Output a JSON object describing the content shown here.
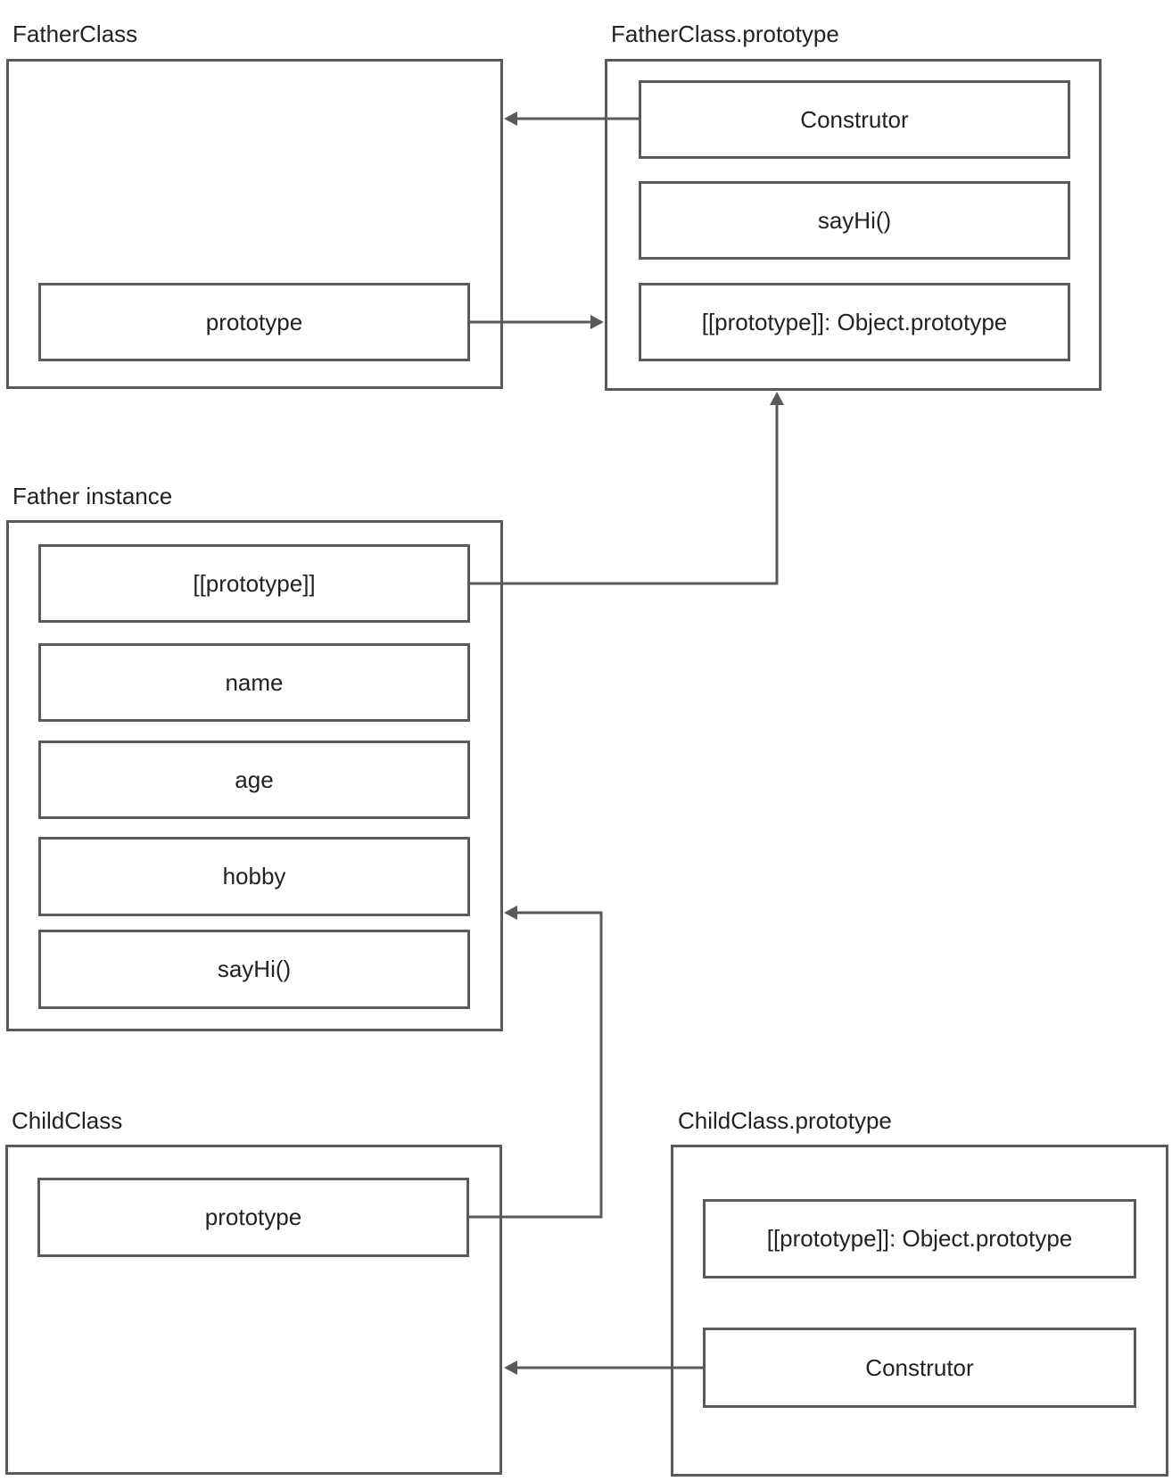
{
  "diagram": {
    "father_class": {
      "label": "FatherClass",
      "fields": [
        "prototype"
      ]
    },
    "father_class_prototype": {
      "label": "FatherClass.prototype",
      "fields": [
        "Construtor",
        "sayHi()",
        "[[prototype]]: Object.prototype"
      ]
    },
    "father_instance": {
      "label": "Father instance",
      "fields": [
        "[[prototype]]",
        "name",
        "age",
        "hobby",
        "sayHi()"
      ]
    },
    "child_class": {
      "label": "ChildClass",
      "fields": [
        "prototype"
      ]
    },
    "child_class_prototype": {
      "label": "ChildClass.prototype",
      "fields": [
        "[[prototype]]: Object.prototype",
        "Construtor"
      ]
    },
    "edges": [
      {
        "from": "FatherClass.prototype.Construtor",
        "to": "FatherClass"
      },
      {
        "from": "FatherClass.prototype",
        "to": "FatherClass.prototype"
      },
      {
        "from": "Father instance.[[prototype]]",
        "to": "FatherClass.prototype"
      },
      {
        "from": "ChildClass.prototype",
        "to": "Father instance"
      },
      {
        "from": "ChildClass.prototype.Construtor",
        "to": "ChildClass"
      }
    ],
    "colors": {
      "stroke": "#5a5a5a",
      "text": "#222222",
      "background": "#ffffff"
    }
  }
}
